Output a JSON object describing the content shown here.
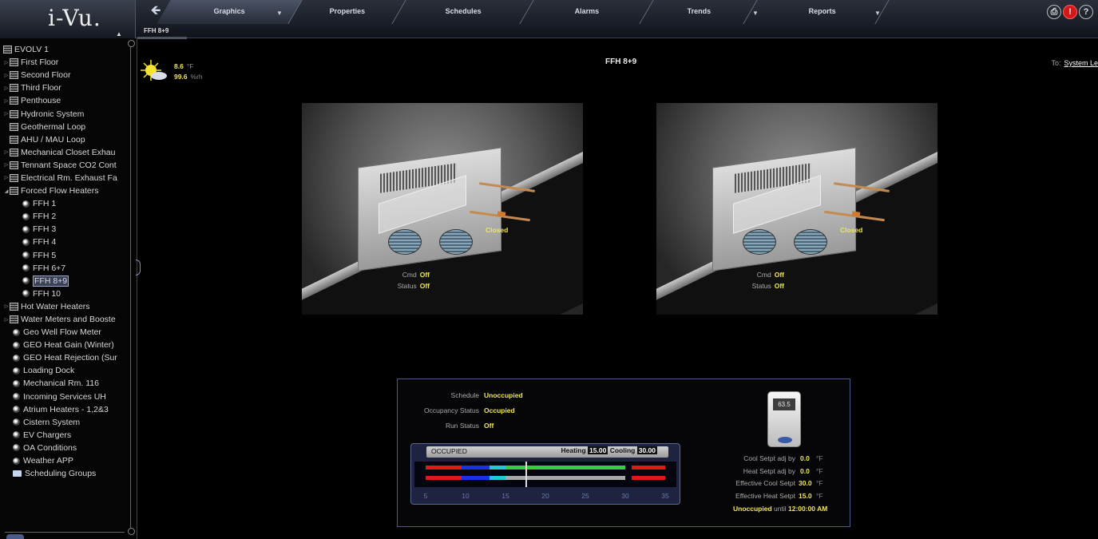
{
  "app": {
    "logo": "i-Vu."
  },
  "nav": {
    "tabs": [
      {
        "label": "Graphics",
        "active": true
      },
      {
        "label": "Properties"
      },
      {
        "label": "Schedules"
      },
      {
        "label": "Alarms"
      },
      {
        "label": "Trends"
      },
      {
        "label": "Reports"
      }
    ],
    "subtab": "FFH 8+9",
    "icons": [
      "print-icon",
      "alarm-icon",
      "help-icon"
    ],
    "icon_glyphs": {
      "print": "⎙",
      "alarm": "!",
      "help": "?"
    }
  },
  "sidebar": {
    "items": [
      {
        "label": "EVOLV 1",
        "icon": "equipment-icon",
        "expand": ""
      },
      {
        "label": "First Floor",
        "icon": "equipment-icon",
        "expand": "collapsed"
      },
      {
        "label": "Second Floor",
        "icon": "equipment-icon",
        "expand": "collapsed"
      },
      {
        "label": "Third Floor",
        "icon": "equipment-icon",
        "expand": "collapsed"
      },
      {
        "label": "Penthouse",
        "icon": "equipment-icon",
        "expand": "collapsed"
      },
      {
        "label": "Hydronic System",
        "icon": "equipment-icon",
        "expand": "collapsed"
      },
      {
        "label": "Geothermal Loop",
        "icon": "equipment-icon",
        "expand": ""
      },
      {
        "label": "AHU / MAU Loop",
        "icon": "equipment-icon",
        "expand": ""
      },
      {
        "label": "Mechanical Closet Exhau",
        "icon": "equipment-icon",
        "expand": "collapsed"
      },
      {
        "label": "Tennant Space CO2 Cont",
        "icon": "equipment-icon",
        "expand": "collapsed"
      },
      {
        "label": "Electrical Rm. Exhaust Fa",
        "icon": "equipment-icon",
        "expand": "collapsed"
      },
      {
        "label": "Forced Flow Heaters",
        "icon": "equipment-icon",
        "expand": "expanded"
      },
      {
        "label": "FFH 1",
        "icon": "control-program-icon",
        "indent": 2
      },
      {
        "label": "FFH 2",
        "icon": "control-program-icon",
        "indent": 2
      },
      {
        "label": "FFH 3",
        "icon": "control-program-icon",
        "indent": 2
      },
      {
        "label": "FFH 4",
        "icon": "control-program-icon",
        "indent": 2
      },
      {
        "label": "FFH 5",
        "icon": "control-program-icon",
        "indent": 2
      },
      {
        "label": "FFH 6+7",
        "icon": "control-program-icon",
        "indent": 2
      },
      {
        "label": "FFH 8+9",
        "icon": "control-program-icon",
        "indent": 2,
        "selected": true
      },
      {
        "label": "FFH 10",
        "icon": "control-program-icon",
        "indent": 2
      },
      {
        "label": "Hot Water Heaters",
        "icon": "equipment-icon",
        "expand": "collapsed"
      },
      {
        "label": "Water Meters and Booste",
        "icon": "equipment-icon",
        "expand": "collapsed"
      },
      {
        "label": "Geo Well Flow Meter",
        "icon": "control-program-icon",
        "indent": 1
      },
      {
        "label": "GEO Heat Gain (Winter)",
        "icon": "control-program-icon",
        "indent": 1
      },
      {
        "label": "GEO Heat Rejection (Sur",
        "icon": "control-program-icon",
        "indent": 1
      },
      {
        "label": "Loading Dock",
        "icon": "control-program-icon",
        "indent": 1
      },
      {
        "label": "Mechanical Rm. 116",
        "icon": "control-program-icon",
        "indent": 1
      },
      {
        "label": "Incoming Services UH",
        "icon": "control-program-icon",
        "indent": 1
      },
      {
        "label": "Atrium Heaters - 1,2&3",
        "icon": "control-program-icon",
        "indent": 1
      },
      {
        "label": "Cistern System",
        "icon": "control-program-icon",
        "indent": 1
      },
      {
        "label": "EV Chargers",
        "icon": "control-program-icon",
        "indent": 1
      },
      {
        "label": "OA Conditions",
        "icon": "control-program-icon",
        "indent": 1
      },
      {
        "label": "Weather APP",
        "icon": "control-program-icon",
        "indent": 1
      },
      {
        "label": "Scheduling Groups",
        "icon": "folder-icon",
        "indent": 1
      }
    ]
  },
  "weather": {
    "temp": "8.6",
    "temp_unit": "°F",
    "humidity": "99.6",
    "humidity_unit": "%rh",
    "icon": "sun-cloud-icon"
  },
  "page": {
    "title": "FFH 8+9",
    "to_label": "To:",
    "to_link": "System Le"
  },
  "heaters": [
    {
      "damper": "Closed",
      "cmd_label": "Cmd",
      "cmd": "Off",
      "status_label": "Status",
      "status": "Off"
    },
    {
      "damper": "Closed",
      "cmd_label": "Cmd",
      "cmd": "Off",
      "status_label": "Status",
      "status": "Off"
    }
  ],
  "control": {
    "schedule_label": "Schedule",
    "schedule": "Unoccupied",
    "occupancy_label": "Occupancy Status",
    "occupancy": "Occupied",
    "run_label": "Run Status",
    "run": "Off",
    "occ_banner": "OCCUPIED",
    "heating_label": "Heating",
    "heating_sp": "15.00",
    "cooling_label": "Cooling",
    "cooling_sp": "30.00",
    "scale_ticks": [
      "5",
      "10",
      "15",
      "20",
      "25",
      "30",
      "35"
    ],
    "thermostat_display": "63.5",
    "cool_adj_label": "Cool Setpt adj by",
    "cool_adj": "0.0",
    "heat_adj_label": "Heat Setpt adj by",
    "heat_adj": "0.0",
    "eff_cool_label": "Effective Cool Setpt",
    "eff_cool": "30.0",
    "eff_heat_label": "Effective Heat Setpt",
    "eff_heat": "15.0",
    "unit": "°F",
    "next_state": "Unoccupied",
    "until_label": "until",
    "next_time": "12:00:00 AM",
    "colors": {
      "heat": "#e01818",
      "deep": "#1830e8",
      "cyan": "#20c8d8",
      "green": "#30d040",
      "gray": "#a8a8a8",
      "text_value": "#f0e850"
    }
  }
}
